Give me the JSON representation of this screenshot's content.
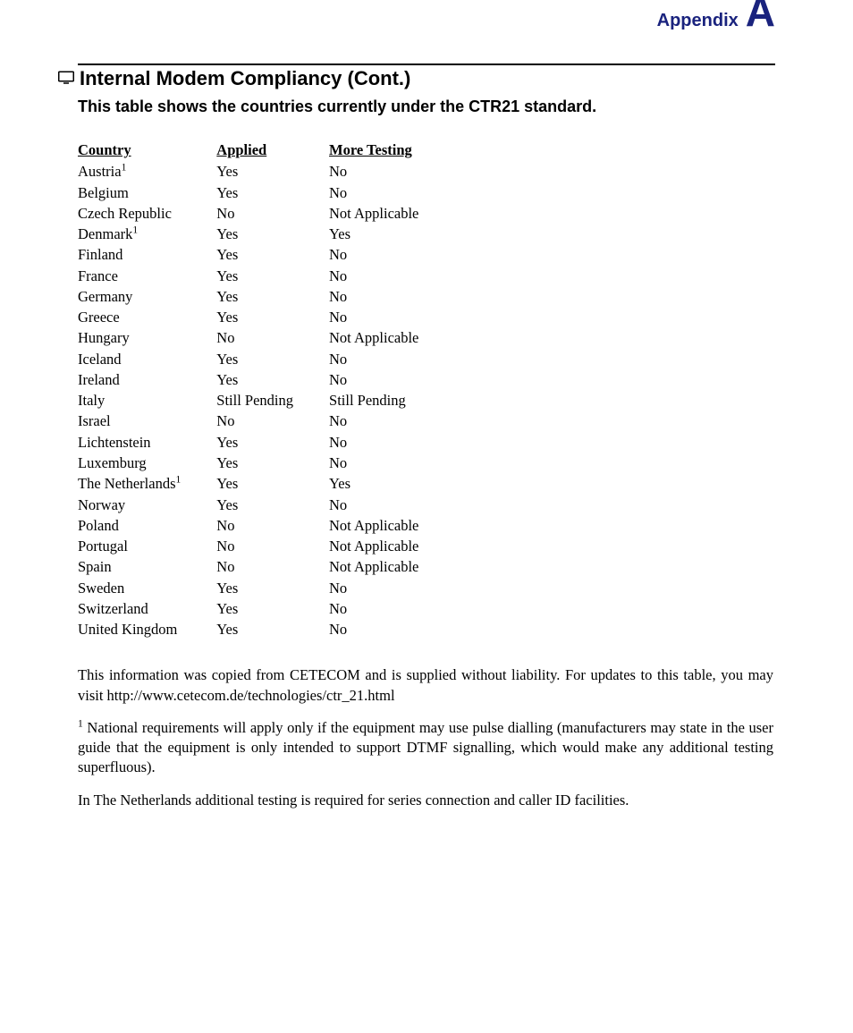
{
  "header": {
    "appendix_word": "Appendix",
    "appendix_letter": "A"
  },
  "section_title": "Internal Modem Compliancy (Cont.)",
  "sub_title": "This table shows the countries currently under the CTR21 standard.",
  "table": {
    "headers": [
      "Country",
      "Applied",
      "More Testing"
    ],
    "rows": [
      {
        "country": "Austria",
        "sup": "1",
        "applied": "Yes",
        "testing": "No"
      },
      {
        "country": "Belgium",
        "sup": "",
        "applied": "Yes",
        "testing": "No"
      },
      {
        "country": "Czech Republic",
        "sup": "",
        "applied": "No",
        "testing": "Not Applicable"
      },
      {
        "country": "Denmark",
        "sup": "1",
        "applied": "Yes",
        "testing": "Yes"
      },
      {
        "country": "Finland",
        "sup": "",
        "applied": "Yes",
        "testing": "No"
      },
      {
        "country": "France",
        "sup": "",
        "applied": "Yes",
        "testing": "No"
      },
      {
        "country": "Germany",
        "sup": "",
        "applied": "Yes",
        "testing": "No"
      },
      {
        "country": "Greece",
        "sup": "",
        "applied": "Yes",
        "testing": "No"
      },
      {
        "country": "Hungary",
        "sup": "",
        "applied": "No",
        "testing": "Not Applicable"
      },
      {
        "country": "Iceland",
        "sup": "",
        "applied": "Yes",
        "testing": "No"
      },
      {
        "country": "Ireland",
        "sup": "",
        "applied": "Yes",
        "testing": "No"
      },
      {
        "country": "Italy",
        "sup": "",
        "applied": "Still Pending",
        "testing": "Still Pending"
      },
      {
        "country": "Israel",
        "sup": "",
        "applied": "No",
        "testing": "No"
      },
      {
        "country": "Lichtenstein",
        "sup": "",
        "applied": "Yes",
        "testing": "No"
      },
      {
        "country": "Luxemburg",
        "sup": "",
        "applied": "Yes",
        "testing": "No"
      },
      {
        "country": "The Netherlands",
        "sup": "1",
        "applied": "Yes",
        "testing": "Yes"
      },
      {
        "country": "Norway",
        "sup": "",
        "applied": "Yes",
        "testing": "No"
      },
      {
        "country": "Poland",
        "sup": "",
        "applied": "No",
        "testing": "Not Applicable"
      },
      {
        "country": "Portugal",
        "sup": "",
        "applied": "No",
        "testing": "Not Applicable"
      },
      {
        "country": "Spain",
        "sup": "",
        "applied": "No",
        "testing": "Not Applicable"
      },
      {
        "country": "Sweden",
        "sup": "",
        "applied": "Yes",
        "testing": "No"
      },
      {
        "country": "Switzerland",
        "sup": "",
        "applied": "Yes",
        "testing": "No"
      },
      {
        "country": "United Kingdom",
        "sup": "",
        "applied": "Yes",
        "testing": "No"
      }
    ]
  },
  "paragraphs": {
    "p1": "This information was copied from CETECOM and is supplied without liability. For updates to this table, you may visit http://www.cetecom.de/technologies/ctr_21.html",
    "p2_sup": "1",
    "p2": " National requirements will apply only if the equipment may use pulse dialling (manufacturers may state in the user guide that the equipment is only intended to support DTMF signalling, which would make any additional testing superfluous).",
    "p3": "In The Netherlands additional testing is required for series connection and caller ID facilities."
  }
}
